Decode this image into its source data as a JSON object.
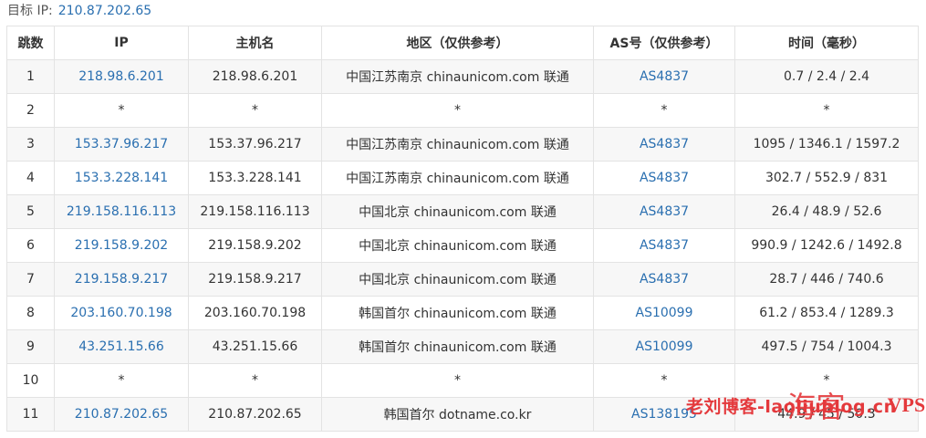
{
  "target": {
    "label": "目标 IP:",
    "ip": "210.87.202.65"
  },
  "table": {
    "headers": [
      "跳数",
      "IP",
      "主机名",
      "地区（仅供参考）",
      "AS号（仅供参考）",
      "时间（毫秒）"
    ],
    "rows": [
      {
        "hop": "1",
        "ip": "218.98.6.201",
        "host": "218.98.6.201",
        "region": "中国江苏南京 chinaunicom.com 联通",
        "as": "AS4837",
        "time": "0.7 / 2.4 / 2.4"
      },
      {
        "hop": "2",
        "ip": "*",
        "host": "*",
        "region": "*",
        "as": "*",
        "time": "*"
      },
      {
        "hop": "3",
        "ip": "153.37.96.217",
        "host": "153.37.96.217",
        "region": "中国江苏南京 chinaunicom.com 联通",
        "as": "AS4837",
        "time": "1095 / 1346.1 / 1597.2"
      },
      {
        "hop": "4",
        "ip": "153.3.228.141",
        "host": "153.3.228.141",
        "region": "中国江苏南京 chinaunicom.com 联通",
        "as": "AS4837",
        "time": "302.7 / 552.9 / 831"
      },
      {
        "hop": "5",
        "ip": "219.158.116.113",
        "host": "219.158.116.113",
        "region": "中国北京 chinaunicom.com 联通",
        "as": "AS4837",
        "time": "26.4 / 48.9 / 52.6"
      },
      {
        "hop": "6",
        "ip": "219.158.9.202",
        "host": "219.158.9.202",
        "region": "中国北京 chinaunicom.com 联通",
        "as": "AS4837",
        "time": "990.9 / 1242.6 / 1492.8"
      },
      {
        "hop": "7",
        "ip": "219.158.9.217",
        "host": "219.158.9.217",
        "region": "中国北京 chinaunicom.com 联通",
        "as": "AS4837",
        "time": "28.7 / 446 / 740.6"
      },
      {
        "hop": "8",
        "ip": "203.160.70.198",
        "host": "203.160.70.198",
        "region": "韩国首尔 chinaunicom.com 联通",
        "as": "AS10099",
        "time": "61.2 / 853.4 / 1289.3"
      },
      {
        "hop": "9",
        "ip": "43.251.15.66",
        "host": "43.251.15.66",
        "region": "韩国首尔 chinaunicom.com 联通",
        "as": "AS10099",
        "time": "497.5 / 754 / 1004.3"
      },
      {
        "hop": "10",
        "ip": "*",
        "host": "*",
        "region": "*",
        "as": "*",
        "time": "*"
      },
      {
        "hop": "11",
        "ip": "210.87.202.65",
        "host": "210.87.202.65",
        "region": "韩国首尔 dotname.co.kr",
        "as": "AS138195",
        "time": "44.9 / 45 / 50.3"
      }
    ]
  },
  "watermark": {
    "text": "老刘博客-laoliublog.cn",
    "seal": "海客",
    "suffix": "VPS"
  },
  "colors": {
    "link": "#2a6fb0",
    "watermark": "#e4393c",
    "stripe": "#f7f7f7",
    "border": "#e3e3e3"
  }
}
